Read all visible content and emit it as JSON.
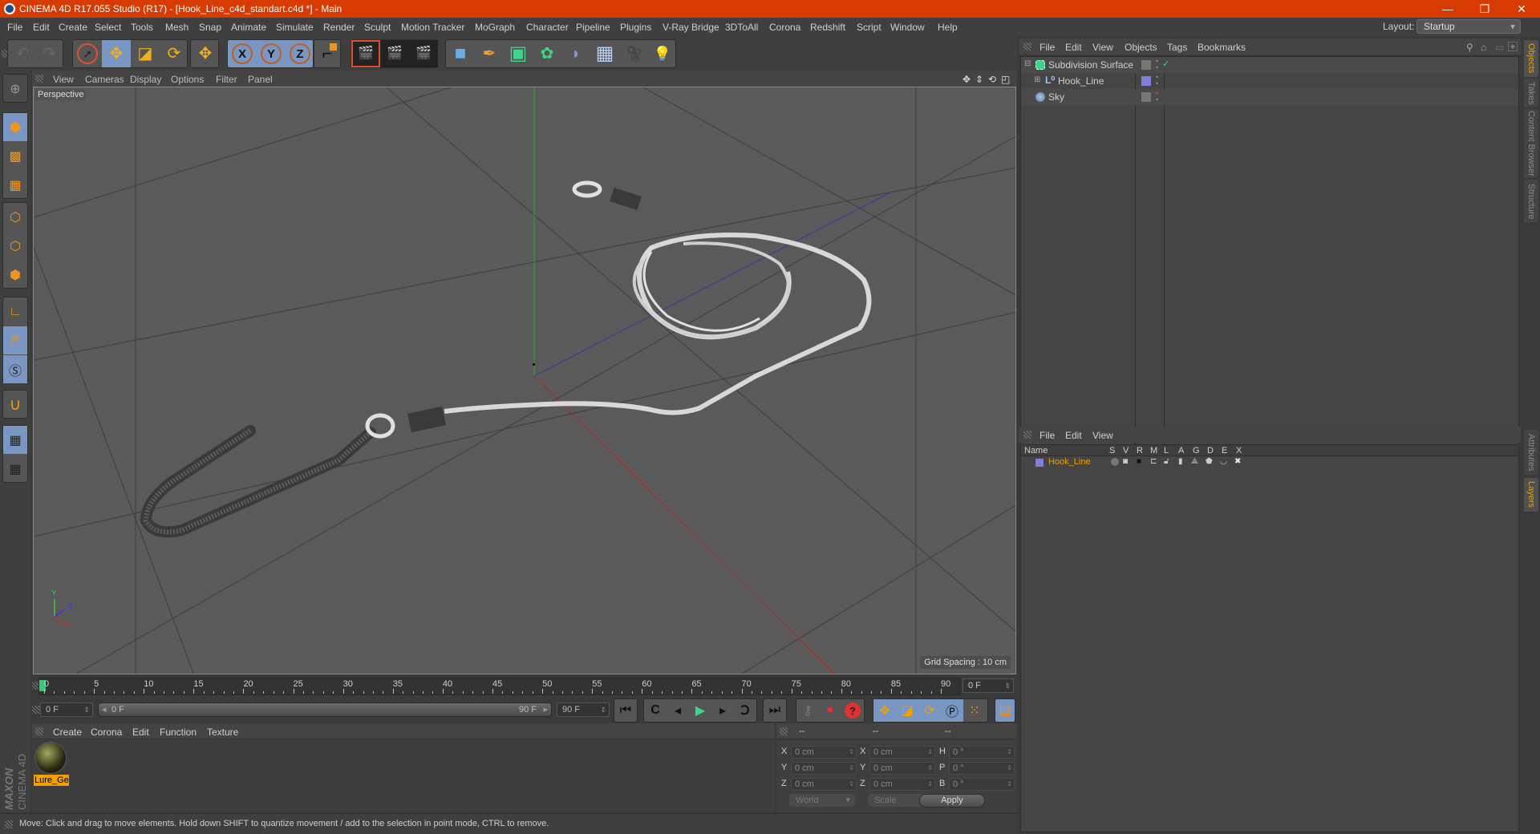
{
  "window": {
    "title": "CINEMA 4D R17.055 Studio (R17) - [Hook_Line_c4d_standart.c4d *] - Main",
    "controls": {
      "minimize": "—",
      "restore": "❐",
      "close": "✕"
    }
  },
  "menubar": {
    "items": [
      "File",
      "Edit",
      "Create",
      "Select",
      "Tools",
      "Mesh",
      "Snap",
      "Animate",
      "Simulate",
      "Render",
      "Sculpt",
      "Motion Tracker",
      "MoGraph",
      "Character",
      "Pipeline",
      "Plugins",
      "V-Ray Bridge",
      "3DToAll",
      "Corona",
      "Redshift",
      "Script",
      "Window",
      "Help"
    ],
    "layout_label": "Layout:",
    "layout_value": "Startup"
  },
  "toolbar": {
    "history": [
      {
        "icon": "undo-icon",
        "glyph": "↶"
      },
      {
        "icon": "redo-icon",
        "glyph": "↷"
      }
    ],
    "tools": [
      {
        "icon": "live-selection-icon",
        "glyph": "➚",
        "selected": false
      },
      {
        "icon": "move-icon",
        "glyph": "✥",
        "selected": true
      },
      {
        "icon": "scale-icon",
        "glyph": "◪",
        "selected": false
      },
      {
        "icon": "rotate-icon",
        "glyph": "⟳",
        "selected": false
      }
    ],
    "last_tool": {
      "icon": "move-icon",
      "glyph": "✥"
    },
    "axes": [
      {
        "icon": "x-axis-lock-icon",
        "label": "X"
      },
      {
        "icon": "y-axis-lock-icon",
        "label": "Y"
      },
      {
        "icon": "z-axis-lock-icon",
        "label": "Z"
      }
    ],
    "coord_system": {
      "icon": "world-coordinate-icon",
      "glyph": "⌐"
    },
    "render": [
      {
        "icon": "render-view-icon",
        "glyph": "🎬"
      },
      {
        "icon": "render-picture-viewer-icon",
        "glyph": "🎬"
      },
      {
        "icon": "render-settings-icon",
        "glyph": "🎬"
      }
    ],
    "objects": [
      {
        "icon": "cube-icon",
        "glyph": "■",
        "color": "#6aaee6"
      },
      {
        "icon": "pen-spline-icon",
        "glyph": "✒",
        "color": "#f0a030"
      },
      {
        "icon": "subdivision-surface-icon",
        "glyph": "▣",
        "color": "#3cd68a"
      },
      {
        "icon": "cloner-icon",
        "glyph": "✿",
        "color": "#3cd68a"
      },
      {
        "icon": "bend-deformer-icon",
        "glyph": "◗",
        "color": "#8a90d0"
      },
      {
        "icon": "floor-icon",
        "glyph": "▦",
        "color": "#b8d0f0"
      },
      {
        "icon": "camera-icon",
        "glyph": "🎥",
        "color": "#cccccc"
      },
      {
        "icon": "light-icon",
        "glyph": "💡",
        "color": "#eeeeee"
      }
    ]
  },
  "left_tools": [
    {
      "icon": "make-editable-icon",
      "glyph": "⊕",
      "selected": false
    },
    {
      "icon": "model-mode-icon",
      "glyph": "⬢",
      "selected": true
    },
    {
      "icon": "texture-mode-icon",
      "glyph": "▩",
      "selected": false
    },
    {
      "icon": "workplane-mode-icon",
      "glyph": "▦",
      "selected": false
    },
    {
      "icon": "points-mode-icon",
      "glyph": "⬡",
      "selected": false
    },
    {
      "icon": "edges-mode-icon",
      "glyph": "⬡",
      "selected": false
    },
    {
      "icon": "polygons-mode-icon",
      "glyph": "⬢",
      "selected": false
    },
    {
      "icon": "axis-mode-icon",
      "glyph": "∟",
      "selected": false
    },
    {
      "icon": "tweak-mode-icon",
      "glyph": "🖱",
      "selected": true
    },
    {
      "icon": "solo-mode-icon",
      "glyph": "Ⓢ",
      "selected": true
    },
    {
      "icon": "snap-magnet-icon",
      "glyph": "∪",
      "selected": false
    },
    {
      "icon": "lock-workplane-icon",
      "glyph": "▦",
      "selected": true
    },
    {
      "icon": "planar-workplane-icon",
      "glyph": "▦",
      "selected": false
    }
  ],
  "viewport": {
    "menu": [
      "View",
      "Cameras",
      "Display",
      "Options",
      "Filter",
      "Panel"
    ],
    "nav_icons": [
      {
        "icon": "pan-icon",
        "glyph": "✥"
      },
      {
        "icon": "dolly-icon",
        "glyph": "⇕"
      },
      {
        "icon": "orbit-icon",
        "glyph": "⟲"
      },
      {
        "icon": "maximize-view-icon",
        "glyph": "◰"
      }
    ],
    "camera_label": "Perspective",
    "grid_spacing": "Grid Spacing : 10 cm",
    "axis_labels": {
      "x": "X",
      "y": "Y",
      "z": "Z"
    }
  },
  "timeline": {
    "ticks": [
      "0",
      "5",
      "10",
      "15",
      "20",
      "25",
      "30",
      "35",
      "40",
      "45",
      "50",
      "55",
      "60",
      "65",
      "70",
      "75",
      "80",
      "85",
      "90"
    ],
    "current_frame": "0 F",
    "end_field": "0 F"
  },
  "transport": {
    "start_field": "0 F",
    "range_start": "0 F",
    "range_end": "90 F",
    "end_field": "90 F",
    "playback": [
      {
        "icon": "go-to-start-icon",
        "glyph": "⏮"
      },
      {
        "icon": "go-previous-key-icon",
        "glyph": "C"
      },
      {
        "icon": "step-back-icon",
        "glyph": "◂"
      },
      {
        "icon": "play-icon",
        "glyph": "▶"
      },
      {
        "icon": "step-forward-icon",
        "glyph": "▸"
      },
      {
        "icon": "go-next-key-icon",
        "glyph": "Ↄ"
      },
      {
        "icon": "go-to-end-icon",
        "glyph": "⏭"
      }
    ],
    "keys": [
      {
        "icon": "record-key-disabled-icon",
        "glyph": "⚷"
      },
      {
        "icon": "auto-keying-icon",
        "glyph": "⏺"
      },
      {
        "icon": "keyframe-selection-icon",
        "glyph": "?"
      }
    ],
    "key_filters": [
      {
        "icon": "key-position-icon",
        "glyph": "✥"
      },
      {
        "icon": "key-scale-icon",
        "glyph": "◪"
      },
      {
        "icon": "key-rotation-icon",
        "glyph": "⟳"
      },
      {
        "icon": "key-parameter-icon",
        "glyph": "Ⓟ"
      },
      {
        "icon": "key-point-level-icon",
        "glyph": "⁙"
      }
    ],
    "timeline_icon": {
      "icon": "timeline-window-icon",
      "glyph": "▤"
    }
  },
  "materials": {
    "menu": [
      "Create",
      "Corona",
      "Edit",
      "Function",
      "Texture"
    ],
    "items": [
      {
        "name": "Lure_Ge"
      }
    ]
  },
  "brand": {
    "maxon": "MAXON",
    "product": "CINEMA 4D"
  },
  "coordinates": {
    "headers": [
      "--",
      "--",
      "--"
    ],
    "rows": [
      {
        "l1": "X",
        "v1": "0 cm",
        "l2": "X",
        "v2": "0 cm",
        "l3": "H",
        "v3": "0 °"
      },
      {
        "l1": "Y",
        "v1": "0 cm",
        "l2": "Y",
        "v2": "0 cm",
        "l3": "P",
        "v3": "0 °"
      },
      {
        "l1": "Z",
        "v1": "0 cm",
        "l2": "Z",
        "v2": "0 cm",
        "l3": "B",
        "v3": "0 °"
      }
    ],
    "space": "World",
    "mode": "Scale",
    "apply": "Apply"
  },
  "status": "Move: Click and drag to move elements. Hold down SHIFT to quantize movement / add to the selection in point mode, CTRL to remove.",
  "object_manager": {
    "menu": [
      "File",
      "Edit",
      "View",
      "Objects",
      "Tags",
      "Bookmarks"
    ],
    "objects": [
      {
        "name": "Subdivision Surface",
        "icon": "subdivision-surface-icon",
        "check": "✓"
      },
      {
        "name": "Hook_Line",
        "icon": "null-object-icon",
        "layer_color": "#8080d8"
      },
      {
        "name": "Sky",
        "icon": "sky-icon"
      }
    ]
  },
  "layer_manager": {
    "menu": [
      "File",
      "Edit",
      "View"
    ],
    "columns": [
      "Name",
      "S",
      "V",
      "R",
      "M",
      "L",
      "A",
      "G",
      "D",
      "E",
      "X"
    ],
    "layers": [
      {
        "name": "Hook_Line",
        "color": "#8080d8"
      }
    ]
  },
  "side_tabs": {
    "top": [
      {
        "label": "Objects",
        "active": true
      },
      {
        "label": "Takes",
        "active": false
      },
      {
        "label": "Content Browser",
        "active": false
      },
      {
        "label": "Structure",
        "active": false
      }
    ],
    "bottom": [
      {
        "label": "Attributes",
        "active": false
      },
      {
        "label": "Layers",
        "active": true
      }
    ]
  },
  "colors": {
    "titlebar": "#d83b01",
    "selection": "#7a96c2",
    "accent_orange": "#f0a000",
    "active_tab": "#f0a000"
  }
}
